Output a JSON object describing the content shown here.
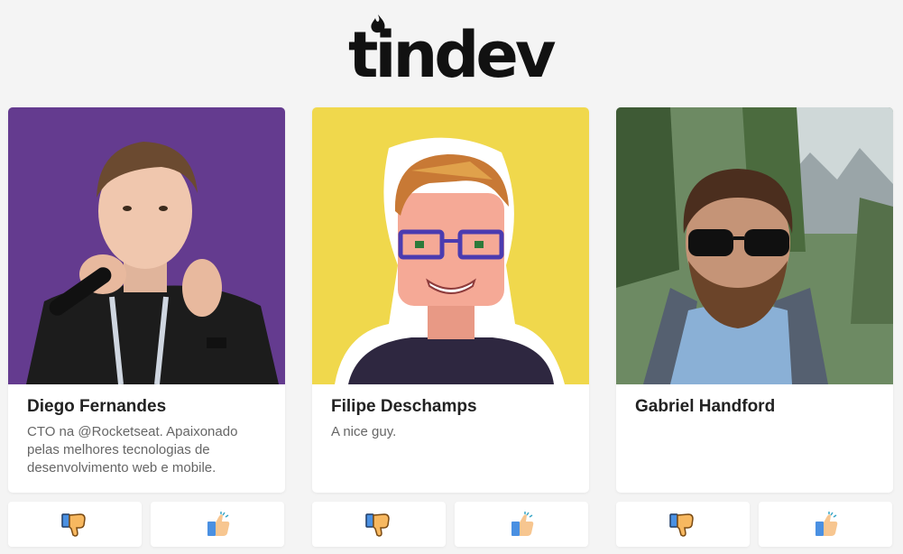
{
  "brand": {
    "logo_text": "tindev"
  },
  "devs": [
    {
      "name": "Diego Fernandes",
      "bio": "CTO na @Rocketseat. Apaixonado pelas melhores tecnologias de desenvolvimento web e mobile.",
      "photo_bg": "#6a3f96"
    },
    {
      "name": "Filipe Deschamps",
      "bio": "A nice guy.",
      "photo_bg": "#f0d84c"
    },
    {
      "name": "Gabriel Handford",
      "bio": "",
      "photo_bg": "#6d8a63"
    }
  ],
  "icons": {
    "dislike": "thumbs-down-icon",
    "like": "thumbs-up-icon"
  },
  "colors": {
    "background": "#f4f4f4",
    "card": "#ffffff",
    "name": "#222222",
    "bio": "#666666",
    "thumb_skin": "#f7b860",
    "thumb_cuff": "#4a90e2"
  }
}
